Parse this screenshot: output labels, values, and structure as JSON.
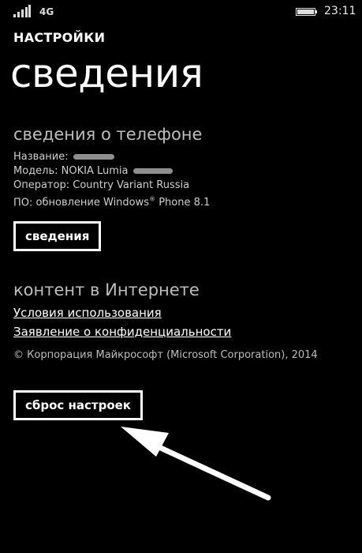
{
  "status_bar": {
    "network": "4G",
    "time": "23:11",
    "signal_icon": "signal-bars-icon",
    "battery_icon": "battery-icon"
  },
  "header": {
    "app_title": "НАСТРОЙКИ",
    "page_title": "сведения"
  },
  "phone_info": {
    "heading": "сведения о телефоне",
    "name_label": "Название:",
    "model_label": "Модель:",
    "model_value": "NOKIA Lumia",
    "operator_label": "Оператор:",
    "operator_value": "Country Variant Russia",
    "software_label": "ПО:",
    "software_value_prefix": "обновление Windows",
    "software_value_reg": "®",
    "software_value_suffix": "Phone 8.1",
    "about_button": "сведения"
  },
  "internet_content": {
    "heading": "контент в Интернете",
    "terms_link": "Условия использования",
    "privacy_link": "Заявление о конфиденциальности",
    "copyright": "© Корпорация Майкрософт (Microsoft Corporation), 2014"
  },
  "reset_button": "сброс настроек",
  "colors": {
    "background": "#000000",
    "text": "#ffffff",
    "subtle_text": "#bdbdbd"
  }
}
